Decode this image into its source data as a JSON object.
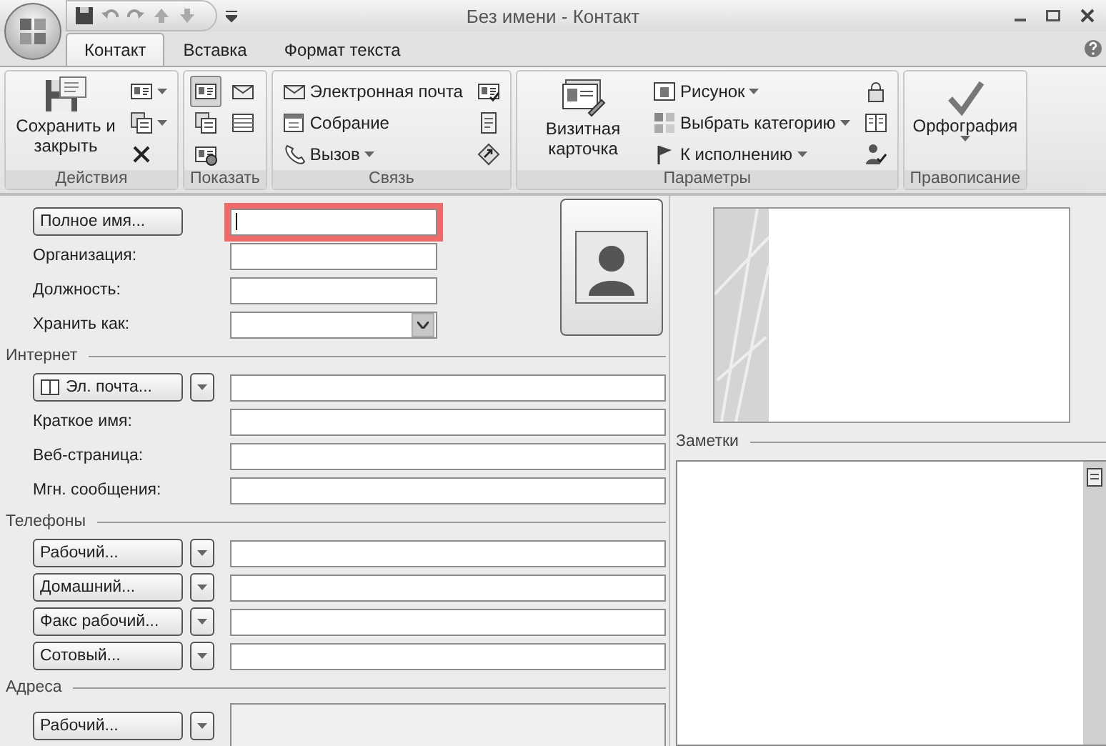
{
  "window": {
    "title": "Без имени - Контакт"
  },
  "tabs": [
    {
      "label": "Контакт",
      "selected": true
    },
    {
      "label": "Вставка",
      "selected": false
    },
    {
      "label": "Формат текста",
      "selected": false
    }
  ],
  "ribbon": {
    "groups": [
      {
        "label": "Действия",
        "items": [
          {
            "kind": "large",
            "label": "Сохранить и закрыть"
          },
          {
            "kind": "icon",
            "dropdown": true
          },
          {
            "kind": "icon",
            "dropdown": true
          },
          {
            "kind": "icon",
            "dropdown": false
          }
        ]
      },
      {
        "label": "Показать",
        "items": [
          {
            "kind": "icon",
            "selected": true
          },
          {
            "kind": "icon",
            "selected": false
          },
          {
            "kind": "icon",
            "selected": false
          },
          {
            "kind": "icon",
            "selected": false
          },
          {
            "kind": "icon",
            "selected": false
          }
        ]
      },
      {
        "label": "Связь",
        "items": [
          {
            "kind": "small",
            "label": "Электронная почта",
            "dropdown": false
          },
          {
            "kind": "small",
            "label": "Собрание",
            "dropdown": false
          },
          {
            "kind": "small",
            "label": "Вызов",
            "dropdown": true
          },
          {
            "kind": "icon",
            "dropdown": false
          },
          {
            "kind": "icon",
            "dropdown": false
          },
          {
            "kind": "icon",
            "dropdown": false
          }
        ]
      },
      {
        "label": "Параметры",
        "items": [
          {
            "kind": "large",
            "label": "Визитная карточка"
          },
          {
            "kind": "small",
            "label": "Рисунок",
            "dropdown": true
          },
          {
            "kind": "small",
            "label": "Выбрать категорию",
            "dropdown": true
          },
          {
            "kind": "small",
            "label": "К исполнению",
            "dropdown": true
          },
          {
            "kind": "icon",
            "dropdown": false
          },
          {
            "kind": "icon",
            "dropdown": false
          },
          {
            "kind": "icon",
            "dropdown": false
          }
        ]
      },
      {
        "label": "Правописание",
        "items": [
          {
            "kind": "large",
            "label": "Орфография",
            "dropdown": true
          }
        ]
      }
    ]
  },
  "form": {
    "sections": [
      {
        "photo": true,
        "rows": [
          {
            "kind": "button",
            "label": "Полное имя...",
            "highlighted": true,
            "focused": true
          },
          {
            "kind": "label",
            "label": "Организация:"
          },
          {
            "kind": "label",
            "label": "Должность:"
          },
          {
            "kind": "select",
            "label": "Хранить как:"
          }
        ]
      },
      {
        "title": "Интернет",
        "rows": [
          {
            "kind": "split",
            "label": "Эл. почта...",
            "book": true
          },
          {
            "kind": "label",
            "label": "Краткое имя:"
          },
          {
            "kind": "label",
            "label": "Веб-страница:"
          },
          {
            "kind": "label",
            "label": "Мгн. сообщения:"
          }
        ]
      },
      {
        "title": "Телефоны",
        "rows": [
          {
            "kind": "split",
            "label": "Рабочий..."
          },
          {
            "kind": "split",
            "label": "Домашний..."
          },
          {
            "kind": "split",
            "label": "Факс рабочий..."
          },
          {
            "kind": "split",
            "label": "Сотовый..."
          }
        ]
      },
      {
        "title": "Адреса",
        "rows": [
          {
            "kind": "split",
            "label": "Рабочий...",
            "tall": true
          }
        ]
      }
    ]
  },
  "notes": {
    "title": "Заметки"
  }
}
